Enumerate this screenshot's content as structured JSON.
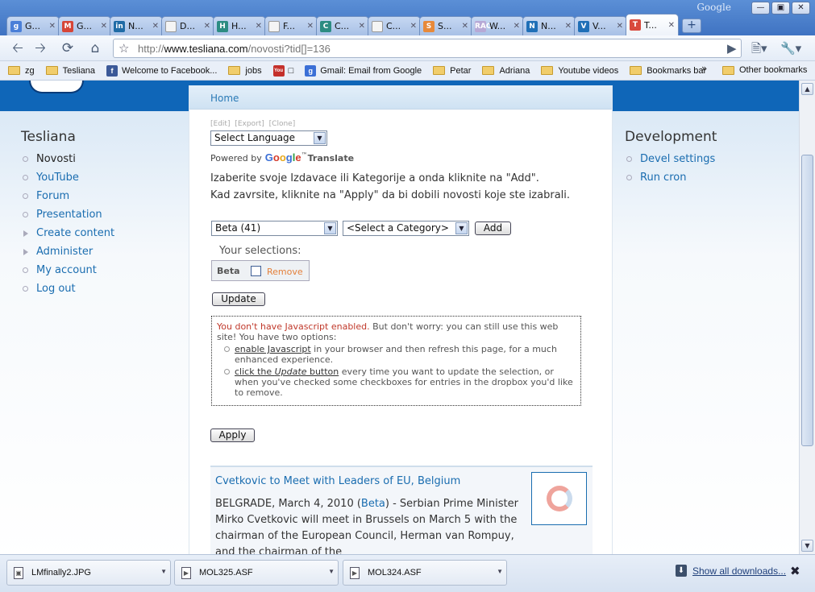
{
  "browser": {
    "brand": "Google",
    "tabs": [
      {
        "title": "G...",
        "favicon": "google-favicon",
        "color": "#4a7fd8",
        "glyph": "g"
      },
      {
        "title": "G...",
        "favicon": "gmail-favicon",
        "color": "#d64537",
        "glyph": "M"
      },
      {
        "title": "N...",
        "favicon": "linkedin-favicon",
        "color": "#1f6ba6",
        "glyph": "in"
      },
      {
        "title": "D...",
        "favicon": "page-favicon",
        "color": "#f4f4f4",
        "glyph": ""
      },
      {
        "title": "H...",
        "favicon": "generic-site-favicon",
        "color": "#2c8c82",
        "glyph": "H"
      },
      {
        "title": "F...",
        "favicon": "page-favicon",
        "color": "#f4f4f4",
        "glyph": ""
      },
      {
        "title": "C...",
        "favicon": "generic-site-favicon",
        "color": "#2c8c82",
        "glyph": "C"
      },
      {
        "title": "C...",
        "favicon": "page-favicon",
        "color": "#f4f4f4",
        "glyph": ""
      },
      {
        "title": "S...",
        "favicon": "person-favicon",
        "color": "#e7893a",
        "glyph": "S"
      },
      {
        "title": "W...",
        "favicon": "rac-favicon",
        "color": "#b7a9d6",
        "glyph": "RAC"
      },
      {
        "title": "N...",
        "favicon": "drupal-favicon",
        "color": "#1f6fb7",
        "glyph": "N"
      },
      {
        "title": "V...",
        "favicon": "drupal-favicon",
        "color": "#1f6fb7",
        "glyph": "V"
      },
      {
        "title": "T...",
        "favicon": "tesliana-favicon",
        "color": "#d94a3d",
        "glyph": "T",
        "active": true
      }
    ],
    "url_domain": "www.tesliana.com",
    "url_prefix": "http://",
    "url_path": "/novosti?tid[]=136",
    "bookmarks": [
      {
        "label": "zg",
        "icon": "folder-icon"
      },
      {
        "label": "Tesliana",
        "icon": "folder-icon"
      },
      {
        "label": "Welcome to Facebook...",
        "icon": "facebook-icon"
      },
      {
        "label": "jobs",
        "icon": "folder-icon"
      },
      {
        "label": "",
        "icon": "youtube-icon"
      },
      {
        "label": "Gmail: Email from Google",
        "icon": "google-icon"
      },
      {
        "label": "Petar",
        "icon": "folder-icon"
      },
      {
        "label": "Adriana",
        "icon": "folder-icon"
      },
      {
        "label": "Youtube videos",
        "icon": "folder-icon"
      },
      {
        "label": "Bookmarks bar",
        "icon": "folder-icon"
      }
    ],
    "bookmarks_chevron": "»",
    "other_bookmarks": "Other bookmarks"
  },
  "page": {
    "left_block": {
      "title": "Tesliana",
      "items": [
        {
          "label": "Novosti",
          "current": true
        },
        {
          "label": "YouTube"
        },
        {
          "label": "Forum"
        },
        {
          "label": "Presentation"
        },
        {
          "label": "Create content",
          "collapsed": true
        },
        {
          "label": "Administer",
          "collapsed": true
        },
        {
          "label": "My account"
        },
        {
          "label": "Log out"
        }
      ]
    },
    "right_block": {
      "title": "Development",
      "items": [
        {
          "label": "Devel settings"
        },
        {
          "label": "Run cron"
        }
      ]
    },
    "breadcrumb": "Home",
    "small_tabs": "[Edit]  [Export]  [Clone]",
    "language_select": "Select Language",
    "powered_by": "Powered by",
    "google_word": "Google",
    "translate_word": "Translate",
    "instruction_line1": "Izaberite svoje Izdavace ili Kategorije a onda kliknite na \"Add\".",
    "instruction_line2": "Kad zavrsite, kliknite na \"Apply\" da bi dobili novosti koje ste izabrali.",
    "publisher_select": "Beta (41)",
    "category_select": "<Select a Category>",
    "add_label": "Add",
    "your_selections": "Your selections:",
    "selection_name": "Beta",
    "remove_label": "Remove",
    "update_label": "Update",
    "js_warning": "You don't have Javascript enabled.",
    "js_rest": " But don't worry: you can still use this web site! You have two options:",
    "js_option1_link": "enable Javascript",
    "js_option1_rest": " in your browser and then refresh this page, for a much enhanced experience.",
    "js_option2_link_a": "click the ",
    "js_option2_link_em": "Update",
    "js_option2_link_b": " button",
    "js_option2_rest": " every time you want to update the selection, or when you've checked some checkboxes for entries in the dropbox you'd like to remove.",
    "apply_label": "Apply",
    "article": {
      "title": "Cvetkovic to Meet with Leaders of EU, Belgium",
      "body_start": "BELGRADE, March 4, 2010 (",
      "body_link": "Beta",
      "body_rest": ") - Serbian Prime Minister Mirko Cvetkovic will meet in Brussels on March 5 with the chairman of the European Council, Herman van Rompuy, and the chairman of the"
    }
  },
  "downloads": {
    "items": [
      {
        "name": "LMfinally2.JPG"
      },
      {
        "name": "MOL325.ASF"
      },
      {
        "name": "MOL324.ASF"
      }
    ],
    "show_all": "Show all downloads..."
  }
}
